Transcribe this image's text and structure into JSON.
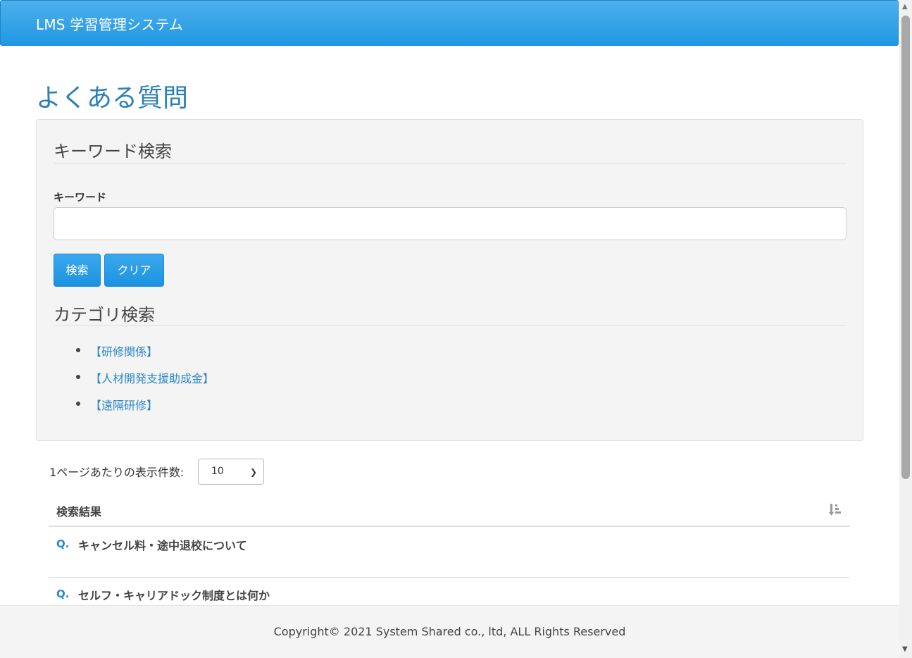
{
  "navbar": {
    "brand": "LMS 学習管理システム"
  },
  "page": {
    "title": "よくある質問"
  },
  "search": {
    "keyword_section_title": "キーワード検索",
    "keyword_label": "キーワード",
    "keyword_value": "",
    "keyword_placeholder": "",
    "search_button": "検索",
    "clear_button": "クリア",
    "category_section_title": "カテゴリ検索",
    "categories": [
      {
        "label": "【研修関係】"
      },
      {
        "label": "【人材開発支援助成金】"
      },
      {
        "label": "【遠隔研修】"
      }
    ]
  },
  "pagination": {
    "per_page_label": "1ページあたりの表示件数:",
    "per_page_value": "10"
  },
  "results": {
    "header": "検索結果",
    "sort_icon": "sort-descending-icon",
    "items": [
      {
        "q": "Q.",
        "title": "キャンセル料・途中退校について"
      },
      {
        "q": "Q.",
        "title": "セルフ・キャリアドック制度とは何か"
      }
    ]
  },
  "footer": {
    "copyright": "Copyright© 2021 System Shared co., ltd, ALL Rights Reserved"
  },
  "colors": {
    "navbar": "#1f97e3",
    "title": "#2a7fb8",
    "link": "#2a87c8",
    "panel_bg": "#f4f4f4"
  }
}
